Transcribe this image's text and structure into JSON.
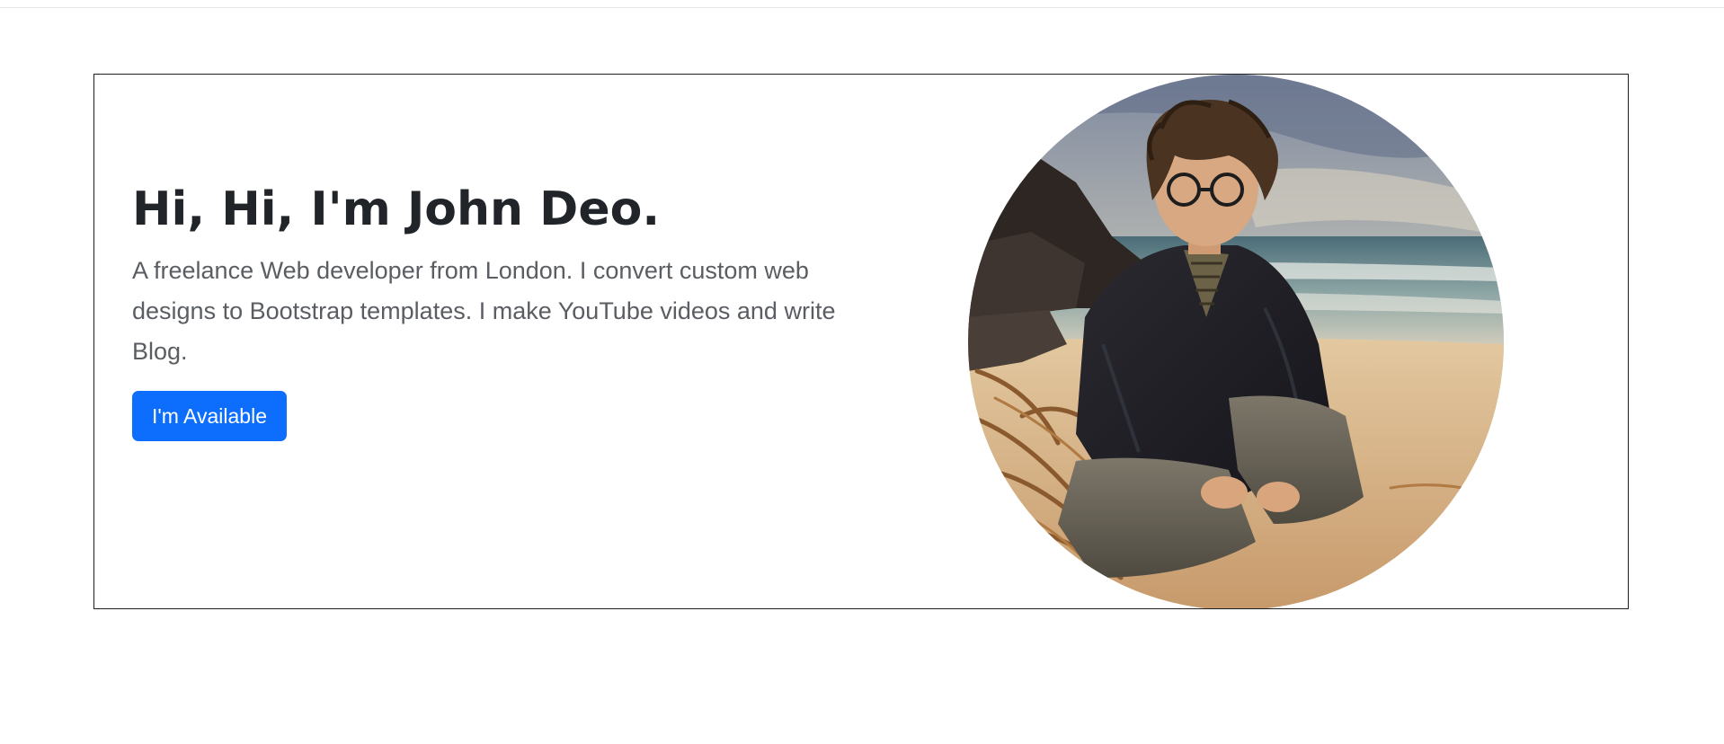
{
  "hero": {
    "title": "Hi, Hi, I'm John Deo.",
    "lead": "A freelance Web developer from London. I convert custom web designs to Bootstrap templates. I make YouTube videos and write Blog.",
    "cta_label": "I'm Available"
  },
  "colors": {
    "button": "#0d6efd",
    "heading": "#212529",
    "lead": "#5a5e63",
    "card_border": "#1f1f1f"
  },
  "portrait": {
    "icon": "portrait-illustration"
  }
}
